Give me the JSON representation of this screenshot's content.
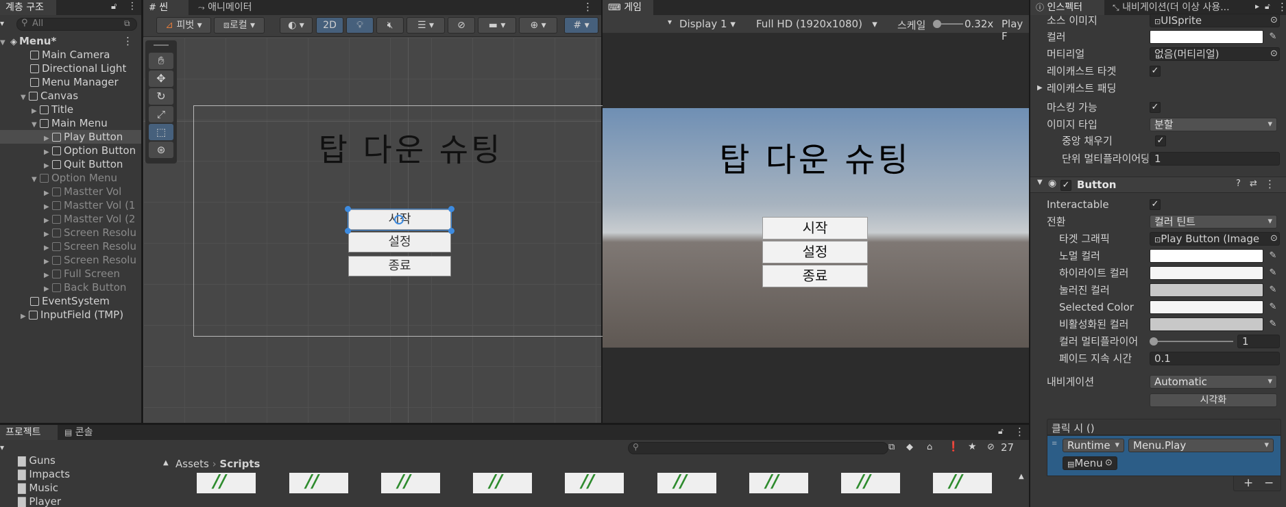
{
  "hierarchy": {
    "title": "계층 구조",
    "search_placeholder": "All",
    "scene": "Menu*",
    "items": [
      {
        "label": "Main Camera"
      },
      {
        "label": "Directional Light"
      },
      {
        "label": "Menu Manager"
      },
      {
        "label": "Canvas"
      },
      {
        "label": "Title"
      },
      {
        "label": "Main Menu"
      },
      {
        "label": "Play Button"
      },
      {
        "label": "Option Button"
      },
      {
        "label": "Quit Button"
      },
      {
        "label": "Option Menu"
      },
      {
        "label": "Mastter Vol"
      },
      {
        "label": "Mastter Vol (1"
      },
      {
        "label": "Mastter Vol (2"
      },
      {
        "label": "Screen Resolu"
      },
      {
        "label": "Screen Resolu"
      },
      {
        "label": "Screen Resolu"
      },
      {
        "label": "Full Screen"
      },
      {
        "label": "Back Button"
      },
      {
        "label": "EventSystem"
      },
      {
        "label": "InputField (TMP)"
      }
    ]
  },
  "scene_view": {
    "tab_scene": "씬",
    "tab_animator": "애니메이터",
    "pivot": "피벗",
    "local": "로컬",
    "mode_2d": "2D",
    "title_text": "탑 다운 슈팅",
    "buttons": [
      "시작",
      "설정",
      "종료"
    ]
  },
  "game_view": {
    "tab": "게임",
    "display": "Display 1",
    "resolution": "Full HD (1920x1080)",
    "scale_label": "스케일",
    "scale_value": "0.32x",
    "play_focused": "Play F",
    "title_text": "탑 다운 슈팅",
    "buttons": [
      "시작",
      "설정",
      "종료"
    ]
  },
  "inspector": {
    "tab": "인스펙터",
    "tab2": "내비게이션(더 이상 사용...",
    "image_rows": [
      {
        "label": "소스 이미지",
        "value": "UISprite"
      },
      {
        "label": "컬러"
      },
      {
        "label": "머티리얼",
        "value": "없음(머티리얼)"
      },
      {
        "label": "레이캐스트 타겟"
      },
      {
        "label": "레이캐스트 패딩"
      },
      {
        "label": "마스킹 가능"
      },
      {
        "label": "이미지 타입",
        "value": "분할"
      },
      {
        "label": "중앙 채우기"
      },
      {
        "label": "단위 멀티플라이어당",
        "value": "1"
      }
    ],
    "component": "Button",
    "button_rows": [
      {
        "label": "Interactable"
      },
      {
        "label": "전환",
        "value": "컬러 틴트"
      },
      {
        "label": "타겟 그래픽",
        "value": "Play Button (Image"
      },
      {
        "label": "노멀 컬러"
      },
      {
        "label": "하이라이트 컬러"
      },
      {
        "label": "눌러진 컬러"
      },
      {
        "label": "Selected Color"
      },
      {
        "label": "비활성화된 컬러"
      },
      {
        "label": "컬러 멀티플라이어",
        "value": "1"
      },
      {
        "label": "페이드 지속 시간",
        "value": "0.1"
      },
      {
        "label": "내비게이션",
        "value": "Automatic"
      }
    ],
    "visualize": "시각화",
    "onclick": "클릭 시 ()",
    "runtime": "Runtime",
    "method": "Menu.Play",
    "object": "Menu",
    "plus": "+",
    "minus": "−"
  },
  "project": {
    "tab_project": "프로젝트",
    "tab_console": "콘솔",
    "folders": [
      "Guns",
      "Impacts",
      "Music",
      "Player"
    ],
    "breadcrumb_root": "Assets",
    "breadcrumb_current": "Scripts",
    "hidden_count": "27"
  },
  "colors": {
    "accent": "#2c5d87",
    "selected_row": "#4d4d4d",
    "panel": "#383838"
  }
}
